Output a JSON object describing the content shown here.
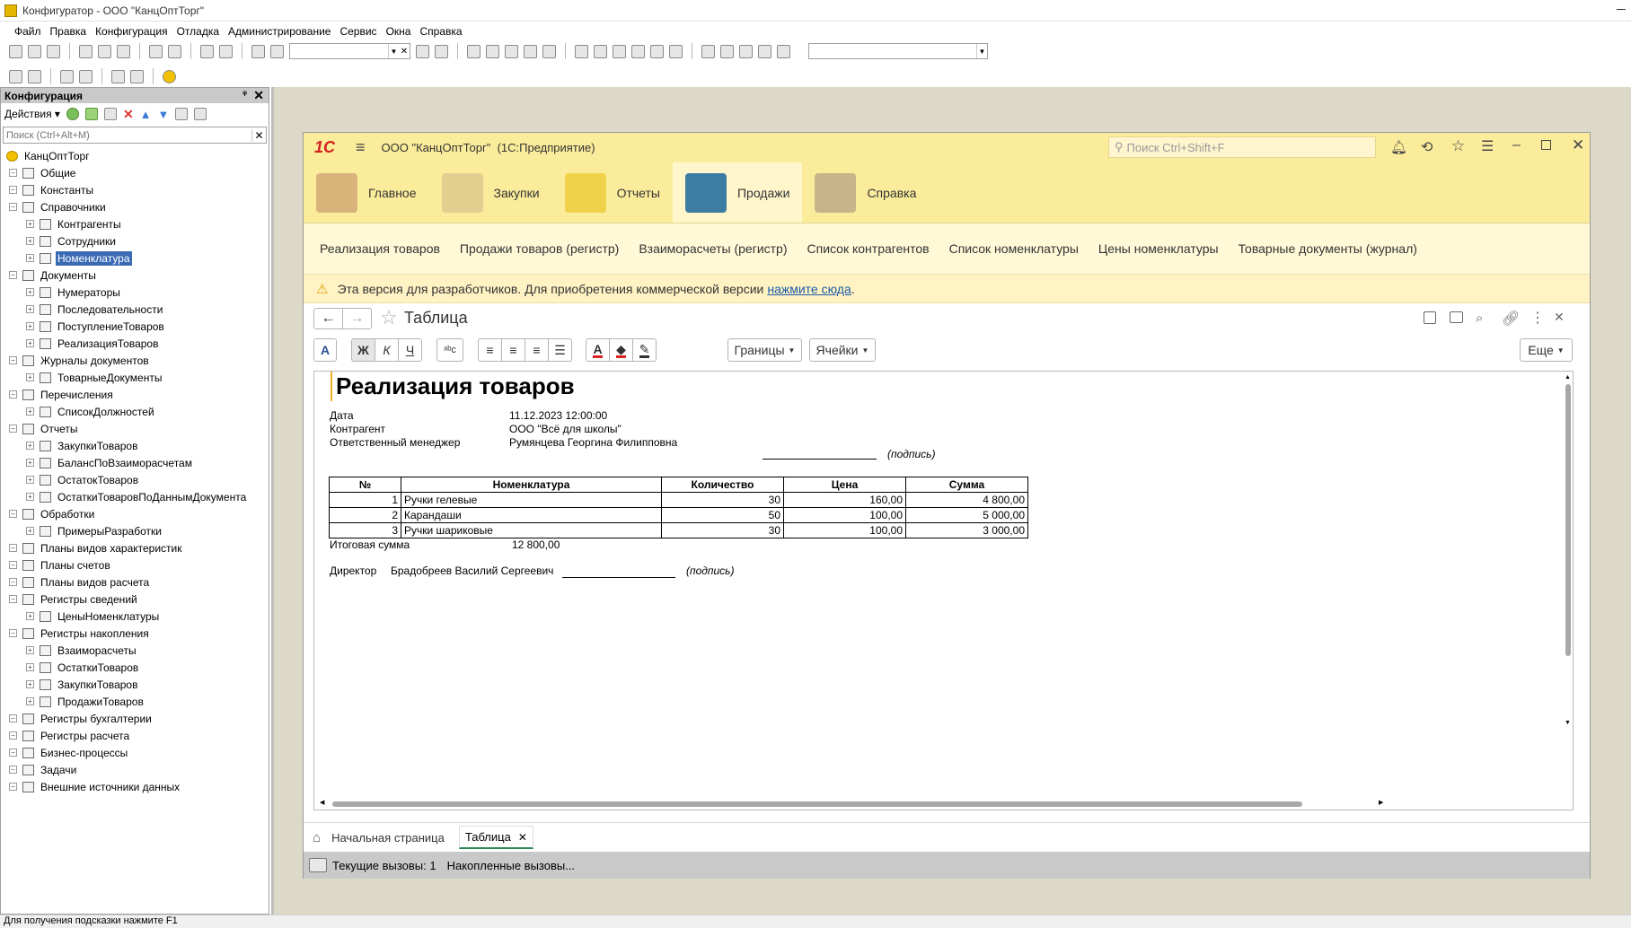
{
  "app": {
    "title": "Конфигуратор - ООО \"КанцОптТорг\""
  },
  "menu": [
    "Файл",
    "Правка",
    "Конфигурация",
    "Отладка",
    "Администрирование",
    "Сервис",
    "Окна",
    "Справка"
  ],
  "config_panel": {
    "title": "Конфигурация",
    "actions_label": "Действия",
    "search_placeholder": "Поиск (Ctrl+Alt+M)",
    "tree": [
      {
        "label": "КанцОптТорг",
        "level": 0
      },
      {
        "label": "Общие",
        "level": 1
      },
      {
        "label": "Константы",
        "level": 1
      },
      {
        "label": "Справочники",
        "level": 1
      },
      {
        "label": "Контрагенты",
        "level": 2
      },
      {
        "label": "Сотрудники",
        "level": 2
      },
      {
        "label": "Номенклатура",
        "level": 2,
        "selected": true
      },
      {
        "label": "Документы",
        "level": 1
      },
      {
        "label": "Нумераторы",
        "level": 2
      },
      {
        "label": "Последовательности",
        "level": 2
      },
      {
        "label": "ПоступлениеТоваров",
        "level": 2
      },
      {
        "label": "РеализацияТоваров",
        "level": 2
      },
      {
        "label": "Журналы документов",
        "level": 1
      },
      {
        "label": "ТоварныеДокументы",
        "level": 2
      },
      {
        "label": "Перечисления",
        "level": 1
      },
      {
        "label": "СписокДолжностей",
        "level": 2
      },
      {
        "label": "Отчеты",
        "level": 1
      },
      {
        "label": "ЗакупкиТоваров",
        "level": 2
      },
      {
        "label": "БалансПоВзаиморасчетам",
        "level": 2
      },
      {
        "label": "ОстатокТоваров",
        "level": 2
      },
      {
        "label": "ОстаткиТоваровПоДаннымДокумента",
        "level": 2
      },
      {
        "label": "Обработки",
        "level": 1
      },
      {
        "label": "ПримерыРазработки",
        "level": 2
      },
      {
        "label": "Планы видов характеристик",
        "level": 1
      },
      {
        "label": "Планы счетов",
        "level": 1
      },
      {
        "label": "Планы видов расчета",
        "level": 1
      },
      {
        "label": "Регистры сведений",
        "level": 1
      },
      {
        "label": "ЦеныНоменклатуры",
        "level": 2
      },
      {
        "label": "Регистры накопления",
        "level": 1
      },
      {
        "label": "Взаиморасчеты",
        "level": 2
      },
      {
        "label": "ОстаткиТоваров",
        "level": 2
      },
      {
        "label": "ЗакупкиТоваров",
        "level": 2
      },
      {
        "label": "ПродажиТоваров",
        "level": 2
      },
      {
        "label": "Регистры бухгалтерии",
        "level": 1
      },
      {
        "label": "Регистры расчета",
        "level": 1
      },
      {
        "label": "Бизнес-процессы",
        "level": 1
      },
      {
        "label": "Задачи",
        "level": 1
      },
      {
        "label": "Внешние источники данных",
        "level": 1
      }
    ]
  },
  "enterprise": {
    "logo": "1С",
    "title": "ООО \"КанцОптТорг\"  (1С:Предприятие)",
    "search_placeholder": "Поиск Ctrl+Shift+F",
    "sections": [
      "Главное",
      "Закупки",
      "Отчеты",
      "Продажи",
      "Справка"
    ],
    "subnav": [
      "Реализация товаров",
      "Продажи товаров (регистр)",
      "Взаиморасчеты (регистр)",
      "Список контрагентов",
      "Список номенклатуры",
      "Цены номенклатуры",
      "Товарные документы (журнал)"
    ],
    "warning_text": "Эта версия для разработчиков. Для приобретения коммерческой версии",
    "warning_link": "нажмите сюда",
    "warning_end": ".",
    "form_title": "Таблица",
    "format_buttons": {
      "font": "A",
      "bold": "Ж",
      "italic": "К",
      "underline": "Ч",
      "borders": "Границы",
      "cells": "Ячейки",
      "more": "Еще"
    },
    "tabs": {
      "home": "Начальная страница",
      "table": "Таблица"
    },
    "calls": {
      "current": "Текущие вызовы: 1",
      "accumulated": "Накопленные вызовы..."
    }
  },
  "document": {
    "heading": "Реализация товаров",
    "fields": [
      {
        "label": "Дата",
        "value": "11.12.2023 12:00:00"
      },
      {
        "label": "Контрагент",
        "value": "ООО \"Всё для школы\""
      },
      {
        "label": "Ответственный менеджер",
        "value": "Румянцева Георгина Филипповна"
      }
    ],
    "signature_hint": "(подпись)",
    "columns": [
      "№",
      "Номенклатура",
      "Количество",
      "Цена",
      "Сумма"
    ],
    "rows": [
      [
        "1",
        "Ручки гелевые",
        "30",
        "160,00",
        "4 800,00"
      ],
      [
        "2",
        "Карандаши",
        "50",
        "100,00",
        "5 000,00"
      ],
      [
        "3",
        "Ручки шариковые",
        "30",
        "100,00",
        "3 000,00"
      ]
    ],
    "total_label": "Итоговая сумма",
    "total_value": "12 800,00",
    "director_label": "Директор",
    "director_name": "Брадобреев Василий Сергеевич"
  },
  "statusbar": {
    "hint": "Для получения подсказки нажмите F1"
  },
  "colors": {
    "panel_yellow": "#fbec9b",
    "selection": "#3b6ab5",
    "workspace": "#dcd9c9"
  }
}
